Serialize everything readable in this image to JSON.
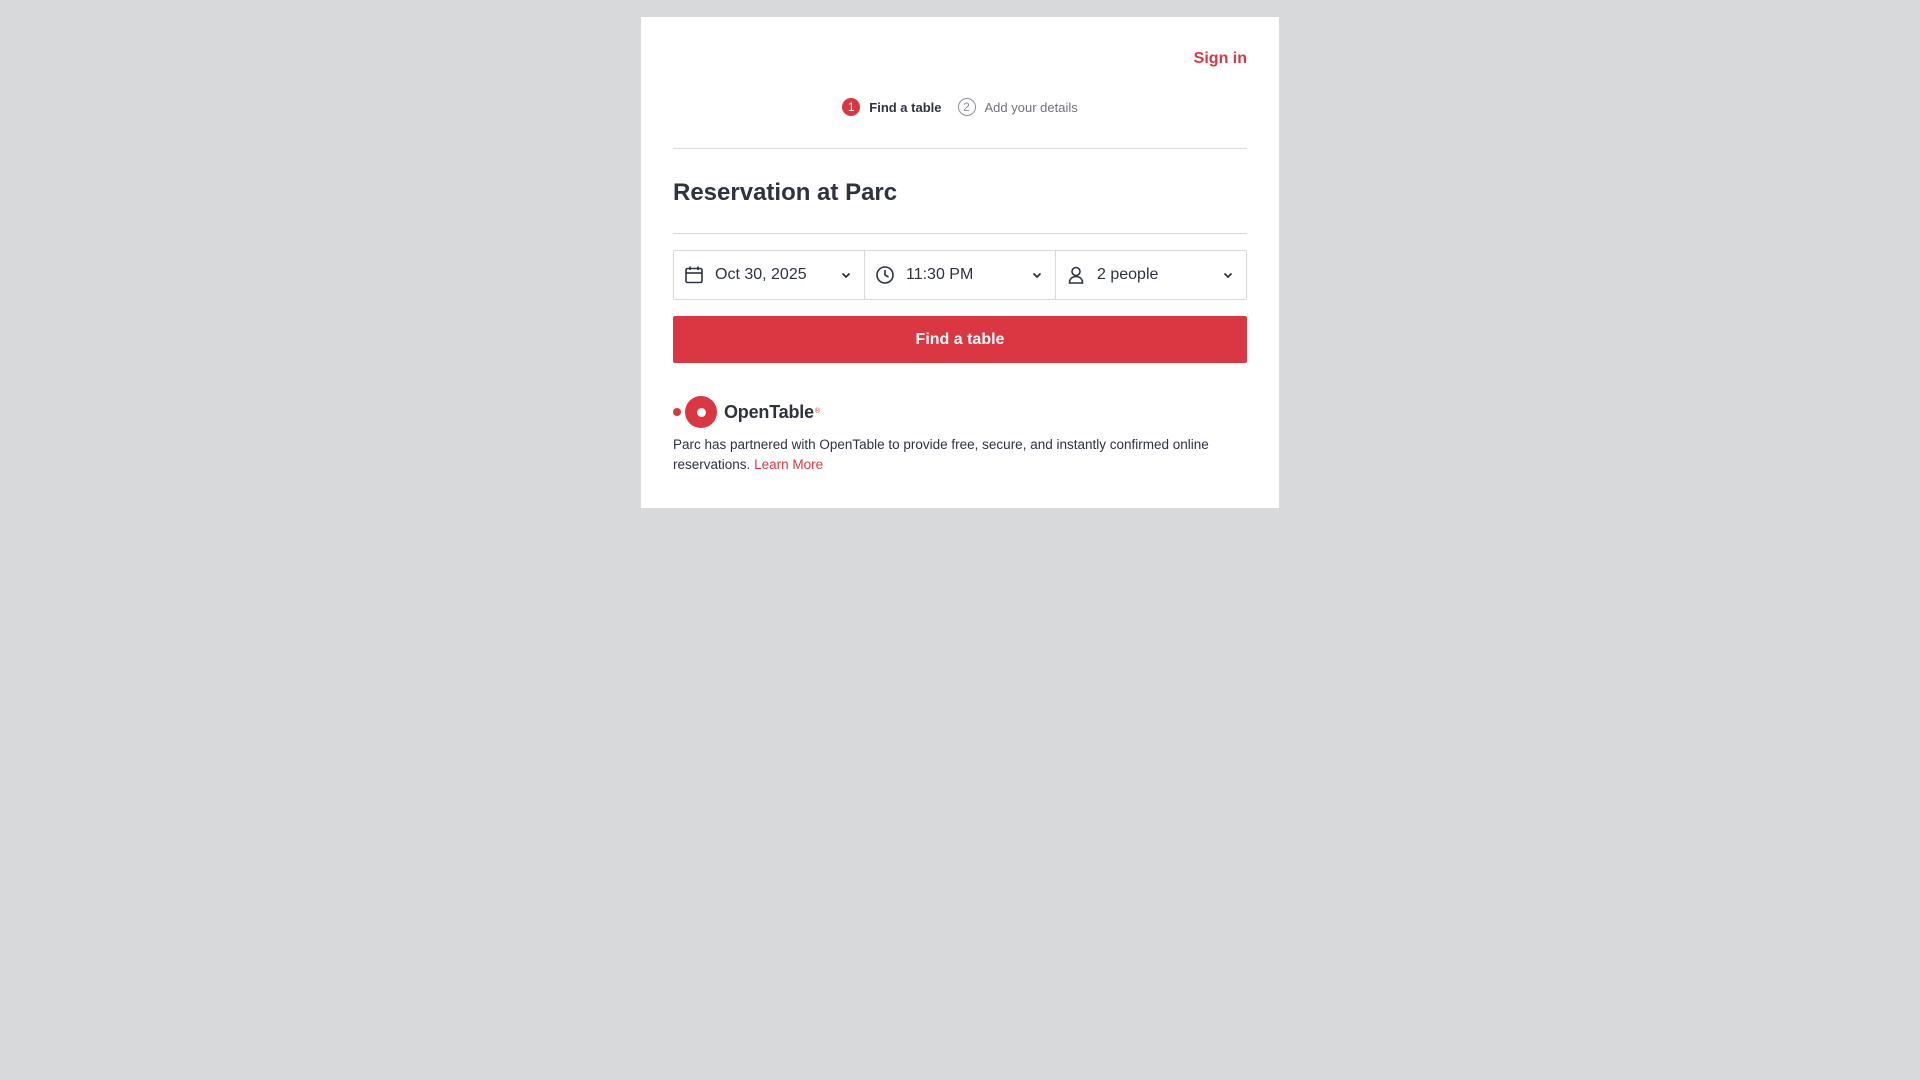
{
  "header": {
    "sign_in_label": "Sign in"
  },
  "steps": [
    {
      "number": "1",
      "label": "Find a table",
      "state": "active"
    },
    {
      "number": "2",
      "label": "Add your details",
      "state": "inactive"
    }
  ],
  "main": {
    "title": "Reservation at Parc"
  },
  "picker": {
    "date_value": "Oct 30, 2025",
    "date_icon": "calendar-icon",
    "time_value": "11:30 PM",
    "time_icon": "clock-icon",
    "party_value": "2 people",
    "party_icon": "person-icon"
  },
  "actions": {
    "find_table_label": "Find a table"
  },
  "footer": {
    "logo_text": "OpenTable",
    "logo_mark": "®",
    "blurb_text": "Parc has partnered with OpenTable to provide free, secure, and instantly confirmed online reservations.",
    "learn_more_label": "Learn More"
  },
  "colors": {
    "brand_red": "#da3743",
    "text_dark": "#2d333f",
    "background": "#d8d9db"
  }
}
